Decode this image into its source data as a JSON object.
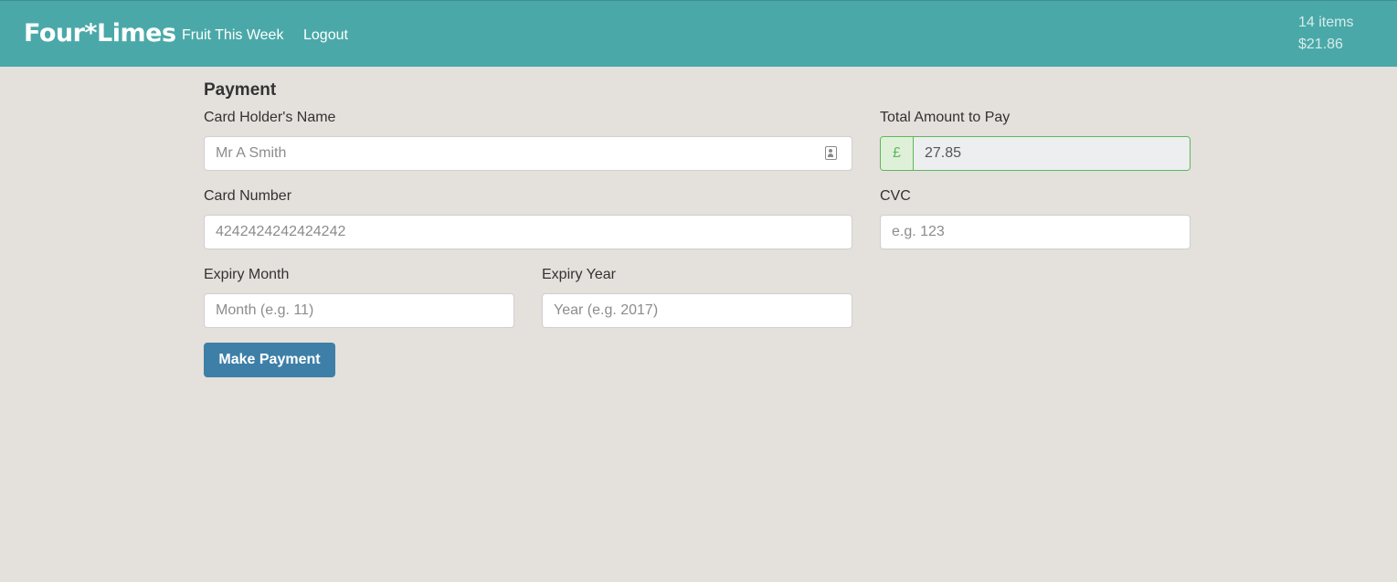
{
  "navbar": {
    "brand": "Four*Limes",
    "links": [
      "Fruit This Week",
      "Logout"
    ],
    "cart": {
      "items": "14 items",
      "total": "$21.86"
    }
  },
  "payment": {
    "title": "Payment",
    "card_holder": {
      "label": "Card Holder's Name",
      "placeholder": "Mr A Smith",
      "value": ""
    },
    "total": {
      "label": "Total Amount to Pay",
      "currency": "£",
      "value": "27.85"
    },
    "card_number": {
      "label": "Card Number",
      "placeholder": "4242424242424242",
      "value": ""
    },
    "cvc": {
      "label": "CVC",
      "placeholder": "e.g. 123",
      "value": ""
    },
    "expiry_month": {
      "label": "Expiry Month",
      "placeholder": "Month (e.g. 11)",
      "value": ""
    },
    "expiry_year": {
      "label": "Expiry Year",
      "placeholder": "Year (e.g. 2017)",
      "value": ""
    },
    "submit_label": "Make Payment"
  },
  "icons": {
    "card_holder_field": "contact-card-icon"
  },
  "colors": {
    "navbar": "#4aa9a8",
    "background": "#e4e0dc",
    "primary_button": "#3e7fa8",
    "success": "#5cb85c"
  }
}
